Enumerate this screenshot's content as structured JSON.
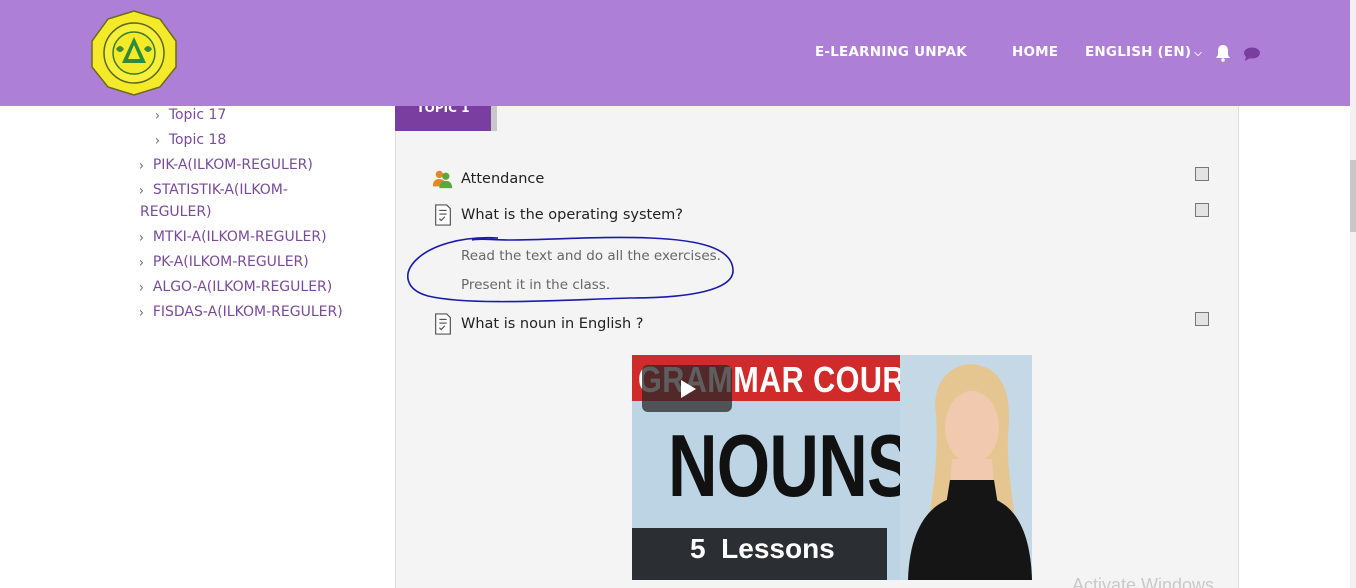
{
  "header": {
    "brand": "E-LEARNING UNPAK",
    "home": "HOME",
    "language": "ENGLISH (EN)",
    "logo_icon": "university-seal-logo",
    "bell_icon": "bell-icon",
    "chat_icon": "chat-icon",
    "bg_color": "#ae7fd6"
  },
  "sidebar": {
    "items": [
      {
        "label": "Topic 17"
      },
      {
        "label": "Topic 18"
      },
      {
        "label": "PIK-A(ILKOM-REGULER)"
      },
      {
        "label": "STATISTIK-A(ILKOM-"
      },
      {
        "label": "REGULER)"
      },
      {
        "label": "MTKI-A(ILKOM-REGULER)"
      },
      {
        "label": "PK-A(ILKOM-REGULER)"
      },
      {
        "label": "ALGO-A(ILKOM-REGULER)"
      },
      {
        "label": "FISDAS-A(ILKOM-REGULER)"
      }
    ]
  },
  "main": {
    "topic_tab": "TOPIC 1",
    "activities": [
      {
        "label": "Attendance",
        "icon": "attendance-icon"
      },
      {
        "label": "What is the operating system?",
        "icon": "assignment-icon"
      },
      {
        "label": "What is noun in English ?",
        "icon": "assignment-icon"
      }
    ],
    "description_lines": [
      "Read the text and do all the exercises.",
      "Present it in the class."
    ],
    "video": {
      "banner": "GRAMMAR COURSE",
      "title": "NOUNS",
      "lessons_number": "5",
      "lessons_word": "Lessons"
    }
  },
  "watermark": "Activate Windows"
}
